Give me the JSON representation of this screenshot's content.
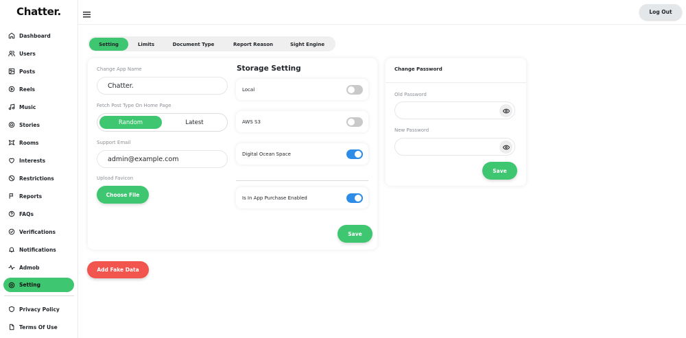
{
  "app": {
    "logo": "Chatter."
  },
  "sidebar": {
    "items": [
      {
        "label": "Dashboard",
        "icon": "home-icon"
      },
      {
        "label": "Users",
        "icon": "users-icon"
      },
      {
        "label": "Posts",
        "icon": "image-icon"
      },
      {
        "label": "Reels",
        "icon": "play-circle-icon"
      },
      {
        "label": "Music",
        "icon": "music-icon"
      },
      {
        "label": "Stories",
        "icon": "stories-icon"
      },
      {
        "label": "Rooms",
        "icon": "rooms-icon"
      },
      {
        "label": "Interests",
        "icon": "heart-icon"
      },
      {
        "label": "Restrictions",
        "icon": "ban-icon"
      },
      {
        "label": "Reports",
        "icon": "flag-icon"
      },
      {
        "label": "FAQs",
        "icon": "help-circle-icon"
      },
      {
        "label": "Verifications",
        "icon": "check-circle-icon"
      },
      {
        "label": "Notifications",
        "icon": "bell-icon"
      },
      {
        "label": "Admob",
        "icon": "activity-icon"
      },
      {
        "label": "Setting",
        "icon": "settings-icon",
        "active": true
      }
    ],
    "footer_items": [
      {
        "label": "Privacy Policy",
        "icon": "shield-icon"
      },
      {
        "label": "Terms Of Use",
        "icon": "file-icon"
      }
    ]
  },
  "header": {
    "logout_label": "Log Out"
  },
  "tabs": [
    {
      "label": "Setting",
      "active": true
    },
    {
      "label": "Limits"
    },
    {
      "label": "Document Type"
    },
    {
      "label": "Report Reason"
    },
    {
      "label": "Sight Engine"
    }
  ],
  "settings": {
    "app_name_label": "Change App Name",
    "app_name_value": "Chatter.",
    "fetch_type_label": "Fetch Post Type On Home Page",
    "fetch_options": [
      "Random",
      "Latest"
    ],
    "fetch_selected": "Random",
    "support_email_label": "Support Email",
    "support_email_value": "admin@example.com",
    "upload_favicon_label": "Upload Favicon",
    "choose_file_label": "Choose File"
  },
  "storage": {
    "title": "Storage Setting",
    "options": [
      {
        "label": "Local",
        "enabled": false
      },
      {
        "label": "AWS S3",
        "enabled": false
      },
      {
        "label": "Digital Ocean Space",
        "enabled": true
      }
    ],
    "in_app_purchase": {
      "label": "Is In App Purchase Enabled",
      "enabled": true
    },
    "save_label": "Save"
  },
  "fake_data": {
    "label": "Add Fake Data"
  },
  "password": {
    "title": "Change Password",
    "old_label": "Old Password",
    "new_label": "New Password",
    "save_label": "Save"
  },
  "colors": {
    "accent": "#3ec670",
    "toggle_on": "#2d8ce8",
    "danger": "#f2544e"
  }
}
